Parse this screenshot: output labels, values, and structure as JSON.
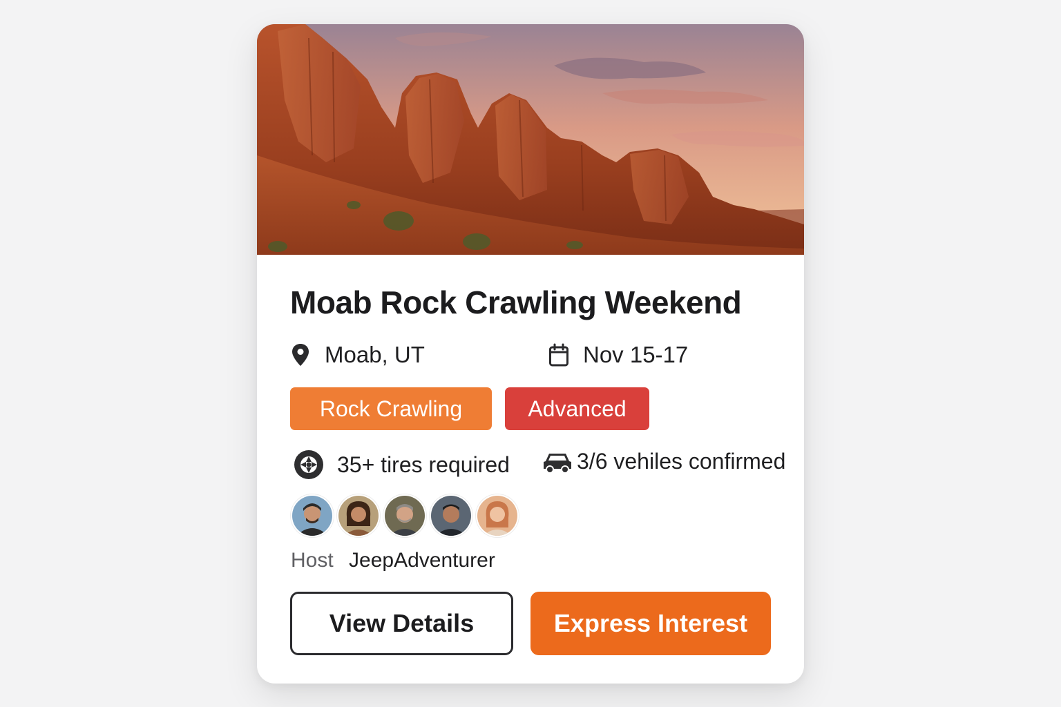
{
  "event": {
    "title": "Moab Rock Crawling Weekend",
    "location": "Moab, UT",
    "dates": "Nov 15-17",
    "tags": [
      {
        "label": "Rock Crawling",
        "color": "#ef7d34"
      },
      {
        "label": "Advanced",
        "color": "#d9403b"
      }
    ],
    "requirements": {
      "tires": "35+ tires required",
      "vehicles": "3/6 vehiles confirmed"
    },
    "attendees_count": 5,
    "host": {
      "label": "Host",
      "name": "JeepAdventurer"
    }
  },
  "actions": {
    "view_details_label": "View Details",
    "express_interest_label": "Express Interest"
  },
  "colors": {
    "accent": "#ec6a1c",
    "tag_type": "#ef7d34",
    "tag_level": "#d9403b",
    "background": "#f3f3f4"
  },
  "icons": {
    "location": "map-pin-icon",
    "date": "calendar-icon",
    "tires": "tire-icon",
    "vehicles": "car-icon"
  }
}
